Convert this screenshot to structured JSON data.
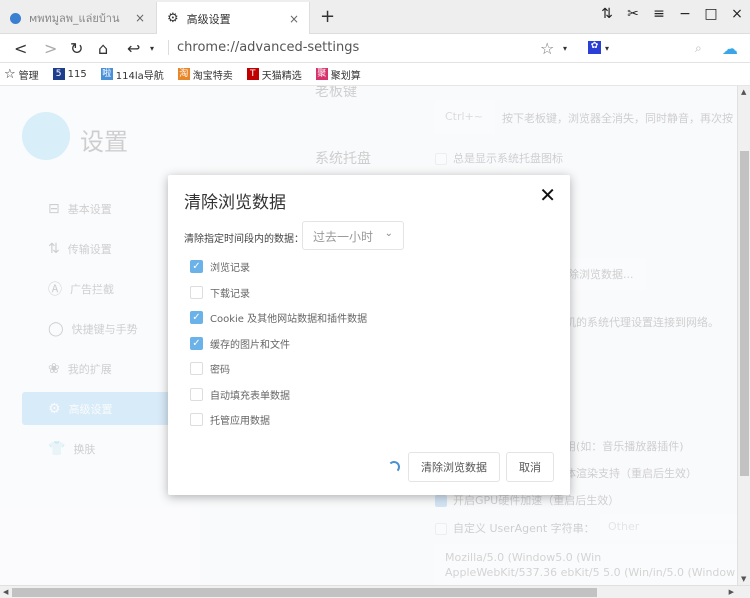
{
  "tabs": [
    {
      "title": "мพทมูลพ_แล่ยบ้าน",
      "close": "×"
    },
    {
      "title": "高级设置",
      "close": "×"
    }
  ],
  "new_tab": "+",
  "window_controls": {
    "transfer": "⇅",
    "cut": "✂",
    "menu": "≡",
    "minimize": "−",
    "maximize": "□",
    "close": "×"
  },
  "address": {
    "url": "chrome://advanced-settings"
  },
  "bookmarks": [
    {
      "label": "管理",
      "color": "#333"
    },
    {
      "label": "115",
      "icon": "5",
      "color": "#1e3e8c"
    },
    {
      "label": "114la导航",
      "icon": "啦",
      "color": "#4a90d9"
    },
    {
      "label": "淘宝特卖",
      "icon": "淘",
      "color": "#e8862a"
    },
    {
      "label": "天猫精选",
      "icon": "T",
      "color": "#c00000"
    },
    {
      "label": "聚划算",
      "icon": "聚",
      "color": "#d6336c"
    }
  ],
  "sidebar": {
    "title": "设置",
    "items": [
      {
        "label": "基本设置",
        "icon": "⊟"
      },
      {
        "label": "传输设置",
        "icon": "⇅"
      },
      {
        "label": "广告拦截",
        "icon": "Ⓐ"
      },
      {
        "label": "快捷键与手势",
        "icon": "◯"
      },
      {
        "label": "我的扩展",
        "icon": "❀"
      },
      {
        "label": "高级设置",
        "icon": "⚙",
        "active": true
      },
      {
        "label": "换肤",
        "icon": "👕"
      }
    ]
  },
  "background": {
    "boss_key_label": "老板键",
    "boss_key_value": "Ctrl+~",
    "boss_key_desc": "按下老板键，浏览器全消失，同时静音，再次按",
    "tray_label": "系统托盘",
    "tray_option": "总是显示系统托盘图标",
    "clear_button": "清除浏览数据...",
    "proxy_desc": "机的系统代理设置连接到网络。",
    "plugin_desc": "用(如：音乐播放器插件)",
    "font_desc": "体渲染支持（重启后生效）",
    "gpu_option": "开启GPU硬件加速（重启后生效）",
    "ua_option": "自定义 UserAgent 字符串：",
    "ua_select": "Other",
    "ua_line1": "Mozilla/5.0 (Window5.0 (Win",
    "ua_line2": "AppleWebKit/537.36 ebKit/5 5.0 (Win/in/5.0 (Window"
  },
  "dialog": {
    "title": "清除浏览数据",
    "range_label": "清除指定时间段内的数据：",
    "range_value": "过去一小时",
    "options": [
      {
        "label": "浏览记录",
        "checked": true
      },
      {
        "label": "下载记录",
        "checked": false
      },
      {
        "label": "Cookie 及其他网站数据和插件数据",
        "checked": true
      },
      {
        "label": "缓存的图片和文件",
        "checked": true
      },
      {
        "label": "密码",
        "checked": false
      },
      {
        "label": "自动填充表单数据",
        "checked": false
      },
      {
        "label": "托管应用数据",
        "checked": false
      }
    ],
    "confirm": "清除浏览数据",
    "cancel": "取消"
  }
}
